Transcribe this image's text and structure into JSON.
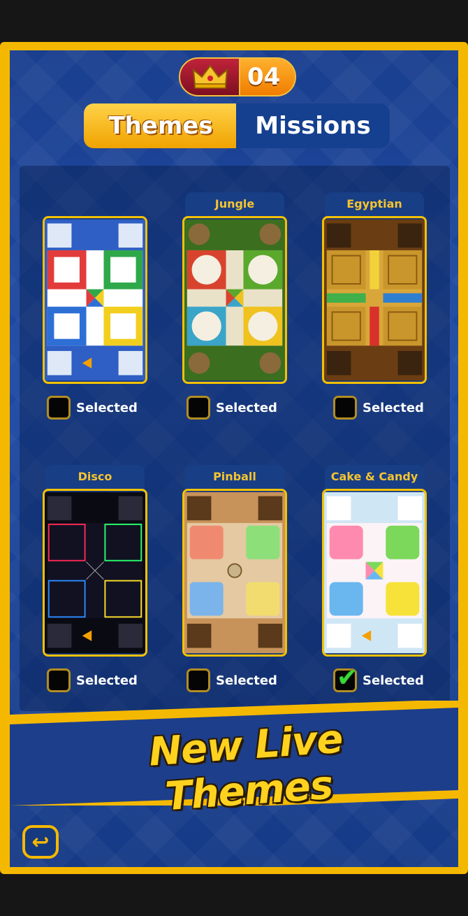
{
  "counter": {
    "value": "04",
    "icon": "crown-icon"
  },
  "tabs": {
    "themes": "Themes",
    "missions": "Missions",
    "active": "Themes"
  },
  "themes": [
    {
      "name": "",
      "selected_label": "Selected",
      "checked": false
    },
    {
      "name": "Jungle",
      "selected_label": "Selected",
      "checked": false
    },
    {
      "name": "Egyptian",
      "selected_label": "Selected",
      "checked": false
    },
    {
      "name": "Disco",
      "selected_label": "Selected",
      "checked": false
    },
    {
      "name": "Pinball",
      "selected_label": "Selected",
      "checked": false
    },
    {
      "name": "Cake & Candy",
      "selected_label": "Selected",
      "checked": true
    }
  ],
  "banner": {
    "text": "New Live Themes"
  },
  "back": {
    "icon": "back-arrow-icon"
  },
  "colors": {
    "frame": "#f5b800",
    "panel": "#1e4aa3",
    "accent": "#ffd21f",
    "check": "#3ad63a"
  }
}
